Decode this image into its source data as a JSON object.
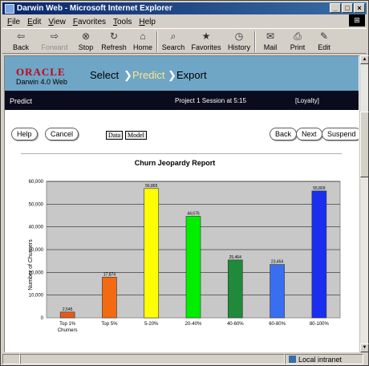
{
  "window": {
    "title": "Darwin Web - Microsoft Internet Explorer"
  },
  "menu": [
    "File",
    "Edit",
    "View",
    "Favorites",
    "Tools",
    "Help"
  ],
  "toolbar": {
    "back": "Back",
    "forward": "Forward",
    "stop": "Stop",
    "refresh": "Refresh",
    "home": "Home",
    "search": "Search",
    "favorites": "Favorites",
    "history": "History",
    "mail": "Mail",
    "print": "Print",
    "edit": "Edit"
  },
  "banner": {
    "logo": "ORACLE",
    "product": "Darwin 4.0 Web",
    "steps": [
      "Select",
      "Predict",
      "Export"
    ],
    "active_step": "Predict",
    "arrow": "❯"
  },
  "infobar": {
    "page": "Predict",
    "session": "Project 1 Session at 5:15",
    "context": "[Loyalty]"
  },
  "buttons": {
    "help": "Help",
    "cancel": "Cancel",
    "data": "Data",
    "model": "Model",
    "back": "Back",
    "next": "Next",
    "suspend": "Suspend"
  },
  "status": {
    "zone": "Local intranet"
  },
  "chart_data": {
    "type": "bar",
    "title": "Churn Jeopardy Report",
    "ylabel": "Number of Churners",
    "xlabel": "",
    "ylim": [
      0,
      60000
    ],
    "yticks": [
      "0",
      "10,000",
      "20,000",
      "30,000",
      "40,000",
      "50,000",
      "60,000"
    ],
    "categories": [
      "Top 1%\nChurners",
      "Top 5%",
      "5-20%",
      "20-40%",
      "40-60%",
      "60-80%",
      "80-100%"
    ],
    "values": [
      2545,
      17874,
      56865,
      44676,
      25464,
      23454,
      55809
    ],
    "value_labels": [
      "2,545",
      "17,874",
      "56,865",
      "44,676",
      "25,464",
      "23,454",
      "55,809"
    ],
    "colors": [
      "#e25a1a",
      "#f26b12",
      "#ffff00",
      "#00ee00",
      "#1e8a3a",
      "#3a6ef0",
      "#1a2ef0"
    ],
    "grid": true
  }
}
